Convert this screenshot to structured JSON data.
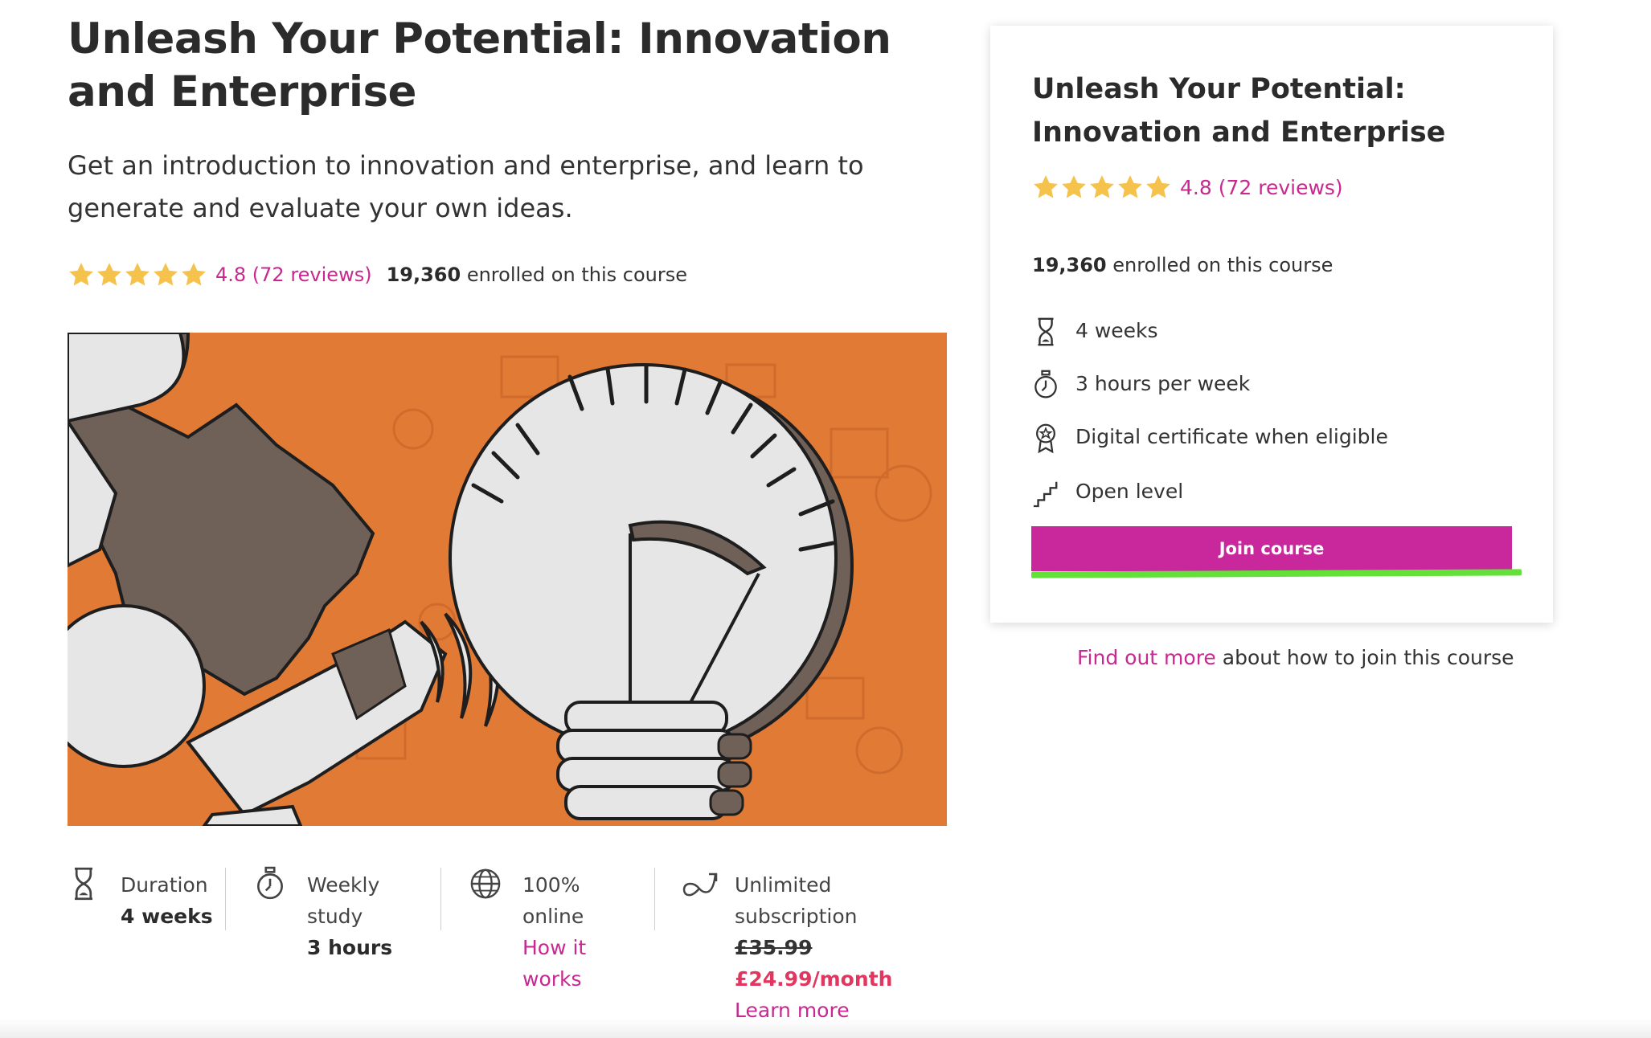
{
  "course": {
    "title": "Unleash Your Potential: Innovation and Enterprise",
    "description": "Get an introduction to innovation and enterprise, and learn to generate and evaluate your own ideas.",
    "rating_text": "4.8 (72 reviews)",
    "rating_value": 4.8,
    "rating_max": 5,
    "enrolled_count": "19,360",
    "enrolled_suffix": " enrolled on this course"
  },
  "facts": {
    "duration": {
      "label": "Duration",
      "value": "4 weeks",
      "icon": "hourglass-icon"
    },
    "study": {
      "label_line1": "Weekly",
      "label_line2": "study",
      "value": "3 hours",
      "icon": "stopwatch-icon"
    },
    "online": {
      "label_line1": "100%",
      "label_line2": "online",
      "link_line1": "How it",
      "link_line2": "works",
      "icon": "globe-icon"
    },
    "subscription": {
      "label_line1": "Unlimited",
      "label_line2": "subscription",
      "old_price": "£35.99",
      "new_price": "£24.99/month",
      "link": "Learn more",
      "icon": "infinity-arrow-icon"
    }
  },
  "card": {
    "title": "Unleash Your Potential: Innovation and Enterprise",
    "rating_text": "4.8 (72 reviews)",
    "enrolled_count": "19,360",
    "enrolled_suffix": " enrolled on this course",
    "items": [
      {
        "text": "4 weeks",
        "icon": "hourglass-icon"
      },
      {
        "text": "3 hours per week",
        "icon": "stopwatch-icon"
      },
      {
        "text": "Digital certificate when eligible",
        "icon": "certificate-icon"
      },
      {
        "text": "Open level",
        "icon": "stairs-icon"
      }
    ],
    "join_label": "Join course"
  },
  "find_more": {
    "link": "Find out more",
    "rest": " about how to join this course"
  },
  "colors": {
    "accent": "#c8289b",
    "link": "#c8288f",
    "price": "#e0365f",
    "star": "#f5c24c",
    "hero_bg": "#e07a35",
    "highlight": "#63e13a"
  }
}
